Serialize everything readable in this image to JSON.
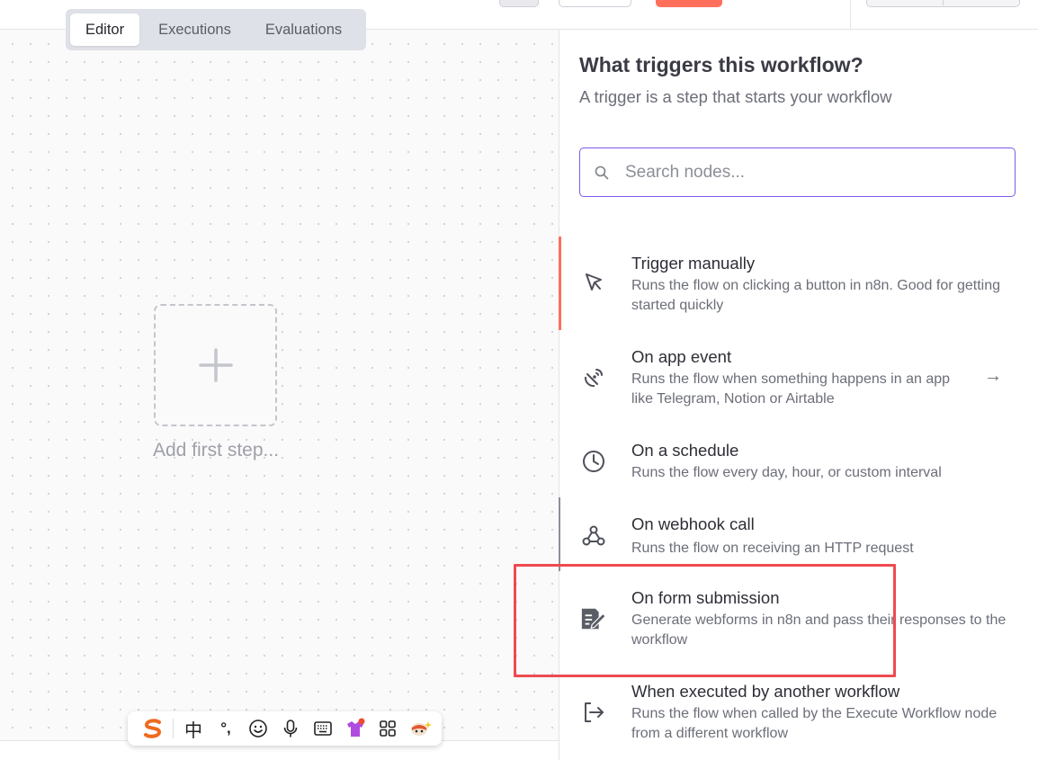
{
  "tabs": [
    {
      "label": "Editor",
      "active": true
    },
    {
      "label": "Executions",
      "active": false
    },
    {
      "label": "Evaluations",
      "active": false
    }
  ],
  "canvas": {
    "add_step_label": "Add first step..."
  },
  "panel": {
    "title": "What triggers this workflow?",
    "subtitle": "A trigger is a step that starts your workflow",
    "search_placeholder": "Search nodes...",
    "items": [
      {
        "icon": "pointer-icon",
        "title": "Trigger manually",
        "desc": "Runs the flow on clicking a button in n8n. Good for getting started quickly",
        "active": true
      },
      {
        "icon": "satellite-dish-icon",
        "title": "On app event",
        "desc": "Runs the flow when something happens in an app like Telegram, Notion or Airtable",
        "has_arrow": true
      },
      {
        "icon": "clock-icon",
        "title": "On a schedule",
        "desc": "Runs the flow every day, hour, or custom interval"
      },
      {
        "icon": "webhook-icon",
        "title": "On webhook call",
        "desc": "Runs the flow on receiving an HTTP request"
      },
      {
        "icon": "form-icon",
        "title": "On form submission",
        "desc": "Generate webforms in n8n and pass their responses to the workflow"
      },
      {
        "icon": "sign-out-icon",
        "title": "When executed by another workflow",
        "desc": "Runs the flow when called by the Execute Workflow node from a different workflow"
      }
    ]
  },
  "ime_toolbar": {
    "chinese_mode": "中",
    "punct": "°,"
  },
  "colors": {
    "accent": "#ff6f5c",
    "search_border": "#7b5ae8",
    "highlight": "#ee4b51"
  }
}
